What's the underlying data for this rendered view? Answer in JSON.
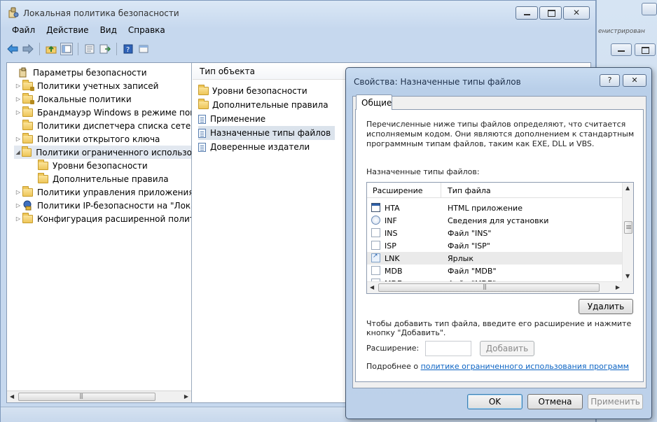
{
  "main_window": {
    "title": "Локальная политика безопасности",
    "menu": [
      "Файл",
      "Действие",
      "Вид",
      "Справка"
    ],
    "bg_fragment": "енистрирован"
  },
  "tree": {
    "items": [
      {
        "label": "Параметры безопасности",
        "arrow": "",
        "icon": "security-settings-icon"
      },
      {
        "label": "Политики учетных записей",
        "arrow": "▷",
        "icon": "folder-lock-icon"
      },
      {
        "label": "Локальные политики",
        "arrow": "▷",
        "icon": "folder-lock-icon"
      },
      {
        "label": "Брандмауэр Windows в режиме пов",
        "arrow": "▷",
        "icon": "folder-icon"
      },
      {
        "label": "Политики диспетчера списка сетей",
        "arrow": "",
        "icon": "folder-icon"
      },
      {
        "label": "Политики открытого ключа",
        "arrow": "▷",
        "icon": "folder-icon"
      },
      {
        "label": "Политики ограниченного использо",
        "arrow": "◢",
        "icon": "folder-icon"
      },
      {
        "label": "Уровни безопасности",
        "arrow": "",
        "icon": "folder-icon"
      },
      {
        "label": "Дополнительные правила",
        "arrow": "",
        "icon": "folder-icon"
      },
      {
        "label": "Политики управления приложения",
        "arrow": "▷",
        "icon": "folder-icon"
      },
      {
        "label": "Политики IP-безопасности на \"Лока",
        "arrow": "▷",
        "icon": "ip-security-icon"
      },
      {
        "label": "Конфигурация расширенной полит",
        "arrow": "▷",
        "icon": "folder-icon"
      }
    ]
  },
  "list": {
    "header": "Тип объекта",
    "items": [
      {
        "label": "Уровни безопасности",
        "icon": "folder-icon"
      },
      {
        "label": "Дополнительные правила",
        "icon": "folder-icon"
      },
      {
        "label": "Применение",
        "icon": "policy-doc-icon"
      },
      {
        "label": "Назначенные типы файлов",
        "icon": "policy-doc-icon"
      },
      {
        "label": "Доверенные издатели",
        "icon": "policy-doc-icon"
      }
    ]
  },
  "dialog": {
    "title": "Свойства: Назначенные типы файлов",
    "help": "?",
    "tab": "Общие",
    "description": "Перечисленные ниже типы файлов определяют, что считается исполняемым кодом. Они являются дополнением к стандартным программным типам файлов, таким как EXE, DLL и VBS.",
    "types_label": "Назначенные типы файлов:",
    "columns": [
      "Расширение",
      "Тип файла"
    ],
    "rows": [
      {
        "ext": "HTA",
        "type": "HTML приложение",
        "icon": "hta-icon"
      },
      {
        "ext": "INF",
        "type": "Сведения для установки",
        "icon": "inf-icon"
      },
      {
        "ext": "INS",
        "type": "Файл \"INS\"",
        "icon": "file-icon"
      },
      {
        "ext": "ISP",
        "type": "Файл \"ISP\"",
        "icon": "file-icon"
      },
      {
        "ext": "LNK",
        "type": "Ярлык",
        "icon": "shortcut-icon"
      },
      {
        "ext": "MDB",
        "type": "Файл \"MDB\"",
        "icon": "file-icon"
      },
      {
        "ext": "MDE",
        "type": "Файл \"MDE\"",
        "icon": "file-icon"
      }
    ],
    "delete_button": "Удалить",
    "hint": "Чтобы добавить тип файла, введите его расширение и нажмите кнопку \"Добавить\".",
    "ext_label": "Расширение:",
    "ext_value": "",
    "add_button": "Добавить",
    "more_prefix": "Подробнее о",
    "more_link": "политике ограниченного использования программ",
    "ok": "OK",
    "cancel": "Отмена",
    "apply": "Применить"
  }
}
